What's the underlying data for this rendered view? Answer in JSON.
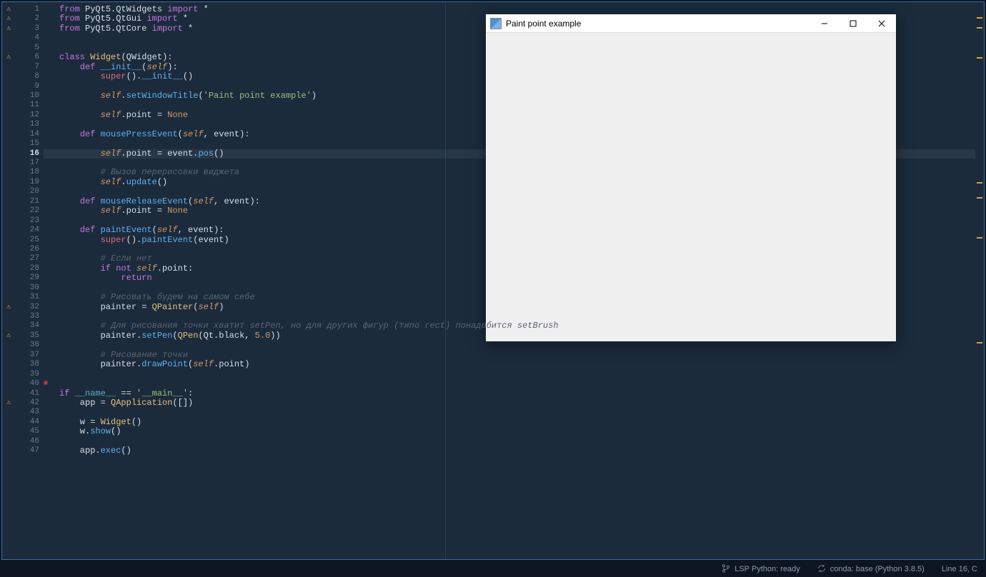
{
  "editor": {
    "highlighted_line_index": 15,
    "eof_marker_line": 39,
    "lines": [
      {
        "n": 1,
        "warn": true,
        "tokens": [
          [
            "kw",
            "from"
          ],
          [
            "ide",
            " PyQt5.QtWidgets "
          ],
          [
            "kw",
            "import"
          ],
          [
            "ide",
            " *"
          ]
        ]
      },
      {
        "n": 2,
        "warn": true,
        "tokens": [
          [
            "kw",
            "from"
          ],
          [
            "ide",
            " PyQt5.QtGui "
          ],
          [
            "kw",
            "import"
          ],
          [
            "ide",
            " *"
          ]
        ]
      },
      {
        "n": 3,
        "warn": true,
        "tokens": [
          [
            "kw",
            "from"
          ],
          [
            "ide",
            " PyQt5.QtCore "
          ],
          [
            "kw",
            "import"
          ],
          [
            "ide",
            " *"
          ]
        ]
      },
      {
        "n": 4,
        "tokens": []
      },
      {
        "n": 5,
        "tokens": []
      },
      {
        "n": 6,
        "warn": true,
        "tokens": [
          [
            "kw",
            "class"
          ],
          [
            "ide",
            " "
          ],
          [
            "cls",
            "Widget"
          ],
          [
            "op",
            "("
          ],
          [
            "ide",
            "QWidget"
          ],
          [
            "op",
            "):"
          ]
        ]
      },
      {
        "n": 7,
        "tokens": [
          [
            "ide",
            "    "
          ],
          [
            "kw",
            "def"
          ],
          [
            "ide",
            " "
          ],
          [
            "fn",
            "__init__"
          ],
          [
            "op",
            "("
          ],
          [
            "slf",
            "self"
          ],
          [
            "op",
            "):"
          ]
        ]
      },
      {
        "n": 8,
        "tokens": [
          [
            "ide",
            "        "
          ],
          [
            "builtin",
            "super"
          ],
          [
            "op",
            "()."
          ],
          [
            "fn",
            "__init__"
          ],
          [
            "op",
            "()"
          ]
        ]
      },
      {
        "n": 9,
        "tokens": []
      },
      {
        "n": 10,
        "tokens": [
          [
            "ide",
            "        "
          ],
          [
            "slf",
            "self"
          ],
          [
            "op",
            "."
          ],
          [
            "fn",
            "setWindowTitle"
          ],
          [
            "op",
            "("
          ],
          [
            "str",
            "'Paint point example'"
          ],
          [
            "op",
            ")"
          ]
        ]
      },
      {
        "n": 11,
        "tokens": []
      },
      {
        "n": 12,
        "tokens": [
          [
            "ide",
            "        "
          ],
          [
            "slf",
            "self"
          ],
          [
            "op",
            ".point = "
          ],
          [
            "none",
            "None"
          ]
        ]
      },
      {
        "n": 13,
        "tokens": []
      },
      {
        "n": 14,
        "tokens": [
          [
            "ide",
            "    "
          ],
          [
            "kw",
            "def"
          ],
          [
            "ide",
            " "
          ],
          [
            "fn",
            "mousePressEvent"
          ],
          [
            "op",
            "("
          ],
          [
            "slf",
            "self"
          ],
          [
            "op",
            ", event):"
          ]
        ]
      },
      {
        "n": 15,
        "tokens": []
      },
      {
        "n": 16,
        "current": true,
        "tokens": [
          [
            "ide",
            "        "
          ],
          [
            "slf",
            "self"
          ],
          [
            "op",
            ".point = event."
          ],
          [
            "fn",
            "pos"
          ],
          [
            "op",
            "()"
          ]
        ]
      },
      {
        "n": 17,
        "tokens": []
      },
      {
        "n": 18,
        "tokens": [
          [
            "ide",
            "        "
          ],
          [
            "cmt",
            "# Вызов перерисовки виджета"
          ]
        ]
      },
      {
        "n": 19,
        "tokens": [
          [
            "ide",
            "        "
          ],
          [
            "slf",
            "self"
          ],
          [
            "op",
            "."
          ],
          [
            "fn",
            "update"
          ],
          [
            "op",
            "()"
          ]
        ]
      },
      {
        "n": 20,
        "tokens": []
      },
      {
        "n": 21,
        "tokens": [
          [
            "ide",
            "    "
          ],
          [
            "kw",
            "def"
          ],
          [
            "ide",
            " "
          ],
          [
            "fn",
            "mouseReleaseEvent"
          ],
          [
            "op",
            "("
          ],
          [
            "slf",
            "self"
          ],
          [
            "op",
            ", event):"
          ]
        ]
      },
      {
        "n": 22,
        "tokens": [
          [
            "ide",
            "        "
          ],
          [
            "slf",
            "self"
          ],
          [
            "op",
            ".point = "
          ],
          [
            "none",
            "None"
          ]
        ]
      },
      {
        "n": 23,
        "tokens": []
      },
      {
        "n": 24,
        "tokens": [
          [
            "ide",
            "    "
          ],
          [
            "kw",
            "def"
          ],
          [
            "ide",
            " "
          ],
          [
            "fn",
            "paintEvent"
          ],
          [
            "op",
            "("
          ],
          [
            "slf",
            "self"
          ],
          [
            "op",
            ", event):"
          ]
        ]
      },
      {
        "n": 25,
        "tokens": [
          [
            "ide",
            "        "
          ],
          [
            "builtin",
            "super"
          ],
          [
            "op",
            "()."
          ],
          [
            "fn",
            "paintEvent"
          ],
          [
            "op",
            "(event)"
          ]
        ]
      },
      {
        "n": 26,
        "tokens": []
      },
      {
        "n": 27,
        "tokens": [
          [
            "ide",
            "        "
          ],
          [
            "cmt",
            "# Если нет"
          ]
        ]
      },
      {
        "n": 28,
        "tokens": [
          [
            "ide",
            "        "
          ],
          [
            "kw",
            "if"
          ],
          [
            "ide",
            " "
          ],
          [
            "kw",
            "not"
          ],
          [
            "ide",
            " "
          ],
          [
            "slf",
            "self"
          ],
          [
            "op",
            ".point:"
          ]
        ]
      },
      {
        "n": 29,
        "tokens": [
          [
            "ide",
            "            "
          ],
          [
            "kw",
            "return"
          ]
        ]
      },
      {
        "n": 30,
        "tokens": []
      },
      {
        "n": 31,
        "tokens": [
          [
            "ide",
            "        "
          ],
          [
            "cmt",
            "# Рисовать будем на самом себе"
          ]
        ]
      },
      {
        "n": 32,
        "warn": true,
        "tokens": [
          [
            "ide",
            "        painter = "
          ],
          [
            "cls",
            "QPainter"
          ],
          [
            "op",
            "("
          ],
          [
            "slf",
            "self"
          ],
          [
            "op",
            ")"
          ]
        ]
      },
      {
        "n": 33,
        "tokens": []
      },
      {
        "n": 34,
        "tokens": [
          [
            "ide",
            "        "
          ],
          [
            "cmt",
            "# Для рисования точки хватит setPen, но для других фигур (типо rect) понадобится setBrush"
          ]
        ]
      },
      {
        "n": 35,
        "warn": true,
        "tokens": [
          [
            "ide",
            "        painter."
          ],
          [
            "fn",
            "setPen"
          ],
          [
            "op",
            "("
          ],
          [
            "cls",
            "QPen"
          ],
          [
            "op",
            "(Qt.black, "
          ],
          [
            "num",
            "5.0"
          ],
          [
            "op",
            "))"
          ]
        ]
      },
      {
        "n": 36,
        "tokens": []
      },
      {
        "n": 37,
        "tokens": [
          [
            "ide",
            "        "
          ],
          [
            "cmt",
            "# Рисование точки"
          ]
        ]
      },
      {
        "n": 38,
        "tokens": [
          [
            "ide",
            "        painter."
          ],
          [
            "fn",
            "drawPoint"
          ],
          [
            "op",
            "("
          ],
          [
            "slf",
            "self"
          ],
          [
            "op",
            ".point)"
          ]
        ]
      },
      {
        "n": 39,
        "tokens": []
      },
      {
        "n": 40,
        "tokens": []
      },
      {
        "n": 41,
        "tokens": [
          [
            "kw",
            "if"
          ],
          [
            "ide",
            " "
          ],
          [
            "dunder",
            "__name__"
          ],
          [
            "ide",
            " == "
          ],
          [
            "str",
            "'__main__'"
          ],
          [
            "op",
            ":"
          ]
        ]
      },
      {
        "n": 42,
        "warn": true,
        "tokens": [
          [
            "ide",
            "    app = "
          ],
          [
            "cls",
            "QApplication"
          ],
          [
            "op",
            "([])"
          ]
        ]
      },
      {
        "n": 43,
        "tokens": []
      },
      {
        "n": 44,
        "tokens": [
          [
            "ide",
            "    w = "
          ],
          [
            "cls",
            "Widget"
          ],
          [
            "op",
            "()"
          ]
        ]
      },
      {
        "n": 45,
        "tokens": [
          [
            "ide",
            "    w."
          ],
          [
            "fn",
            "show"
          ],
          [
            "op",
            "()"
          ]
        ]
      },
      {
        "n": 46,
        "tokens": []
      },
      {
        "n": 47,
        "tokens": [
          [
            "ide",
            "    app."
          ],
          [
            "fn",
            "exec"
          ],
          [
            "op",
            "()"
          ]
        ]
      }
    ]
  },
  "popup": {
    "title": "Paint point example",
    "min": "—",
    "max": "□",
    "close": "✕"
  },
  "status": {
    "lsp": "LSP Python: ready",
    "conda": "conda: base (Python 3.8.5)",
    "linecol": "Line 16, C"
  },
  "minimap_marks_pct": [
    3,
    5,
    11,
    36,
    39,
    47,
    68
  ]
}
